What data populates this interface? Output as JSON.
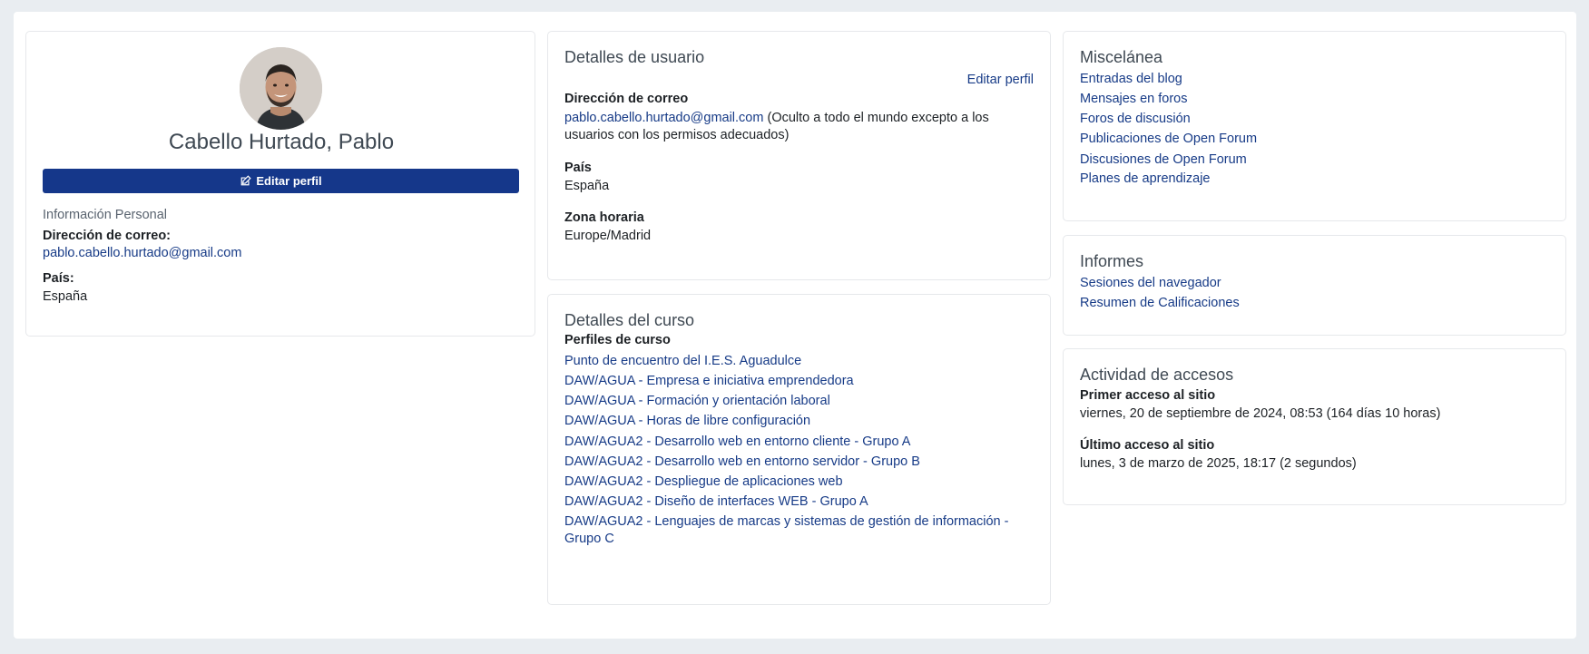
{
  "profile": {
    "full_name": "Cabello Hurtado, Pablo",
    "edit_button": "Editar perfil",
    "section_title": "Información Personal",
    "email_label": "Dirección de correo:",
    "email_value": "pablo.cabello.hurtado@gmail.com",
    "country_label": "País:",
    "country_value": "España"
  },
  "user_details": {
    "title": "Detalles de usuario",
    "edit_link": "Editar perfil",
    "email_label": "Dirección de correo",
    "email_value": "pablo.cabello.hurtado@gmail.com",
    "email_note_line1": "(Oculto a todo el mundo excepto a los",
    "email_note_line2": "usuarios con los permisos adecuados)",
    "country_label": "País",
    "country_value": "España",
    "timezone_label": "Zona horaria",
    "timezone_value": "Europe/Madrid"
  },
  "course_details": {
    "title": "Detalles del curso",
    "profiles_label": "Perfiles de curso",
    "courses": [
      "Punto de encuentro del I.E.S. Aguadulce",
      "DAW/AGUA - Empresa e iniciativa emprendedora",
      "DAW/AGUA - Formación y orientación laboral",
      "DAW/AGUA - Horas de libre configuración",
      "DAW/AGUA2 - Desarrollo web en entorno cliente - Grupo A",
      "DAW/AGUA2 - Desarrollo web en entorno servidor - Grupo B",
      "DAW/AGUA2 - Despliegue de aplicaciones web",
      "DAW/AGUA2 - Diseño de interfaces WEB - Grupo A",
      "DAW/AGUA2 - Lenguajes de marcas y sistemas de gestión de información -",
      "Grupo C"
    ]
  },
  "misc": {
    "title": "Miscelánea",
    "links": [
      "Entradas del blog",
      "Mensajes en foros",
      "Foros de discusión",
      "Publicaciones de Open Forum",
      "Discusiones de Open Forum",
      "Planes de aprendizaje"
    ]
  },
  "reports": {
    "title": "Informes",
    "links": [
      "Sesiones del navegador",
      "Resumen de Calificaciones"
    ]
  },
  "access": {
    "title": "Actividad de accesos",
    "first_label": "Primer acceso al sitio",
    "first_value": "viernes, 20 de septiembre de 2024, 08:53  (164 días 10 horas)",
    "last_label": "Último acceso al sitio",
    "last_value": "lunes, 3 de marzo de 2025, 18:17  (2 segundos)"
  },
  "colors": {
    "link": "#173b87",
    "button_bg": "#15378a",
    "page_bg": "#e9edf1"
  }
}
